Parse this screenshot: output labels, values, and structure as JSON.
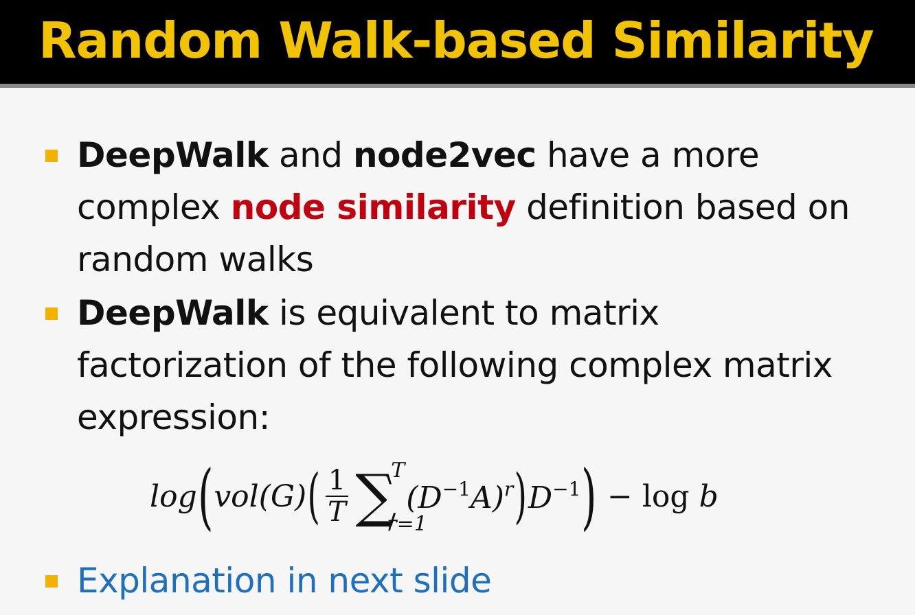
{
  "title": "Random Walk-based Similarity",
  "bullets": [
    {
      "line1_b1": "DeepWalk",
      "line1_t1": " and ",
      "line1_b2": "node2vec",
      "line1_t2": " have a more",
      "line2_t1": "complex ",
      "line2_hl": "node similarity",
      "line2_t2": " definition based on",
      "line3": "random walks"
    },
    {
      "line1_b1": "DeepWalk",
      "line1_t1": " is equivalent to matrix",
      "line2": "factorization of the following complex matrix",
      "line3": "expression:"
    },
    {
      "text": "Explanation in next slide"
    }
  ],
  "formula": {
    "log": "log",
    "vol": "vol(G)",
    "frac_num": "1",
    "frac_den": "T",
    "sum_sup": "T",
    "sum_sub": "r=1",
    "term": "(D",
    "term_exp": "−1",
    "term2": "A)",
    "term2_exp": "r",
    "d": "D",
    "d_exp": "−1",
    "tail": " − log ",
    "b": "b"
  },
  "colors": {
    "title": "#f2c300",
    "bullet": "#f2b200",
    "highlight": "#c0000f",
    "link_blue": "#1f6fbf"
  }
}
